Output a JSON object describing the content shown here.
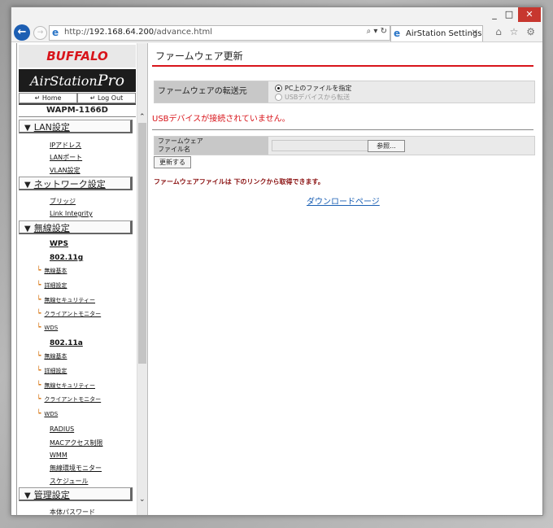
{
  "browser": {
    "window_controls": {
      "minimize": "_",
      "maximize": "□",
      "close": "✕"
    },
    "back_icon": "←",
    "forward_icon": "→",
    "url_prefix": "http://",
    "url_host": "192.168.64.200",
    "url_path": "/advance.html",
    "address_tools": "⌕ ▾ ↻",
    "tab_title": "AirStation Settings",
    "tab_close": "✕",
    "toolbar_icons": "⌂ ☆ ⚙"
  },
  "sidebar": {
    "brand": "BUFFALO",
    "product": "AirStation",
    "product_suffix": "Pro",
    "home": "Home",
    "logout": "Log Out",
    "model": "WAPM-1166D",
    "sections": [
      {
        "label": "LAN設定"
      },
      {
        "label": "ネットワーク設定"
      },
      {
        "label": "無線設定"
      },
      {
        "label": "管理設定"
      }
    ],
    "lan_links": [
      "IPアドレス",
      "LANポート",
      "VLAN設定"
    ],
    "network_links": [
      "ブリッジ",
      "Link Integrity"
    ],
    "wireless_top": "WPS",
    "band_g": "802.11g",
    "band_a": "802.11a",
    "sub_items": [
      "無線基本",
      "詳細設定",
      "無線セキュリティー",
      "クライアントモニター",
      "WDS"
    ],
    "wireless_links": [
      "RADIUS",
      "MACアクセス制限",
      "WMM",
      "無線環境モニター",
      "スケジュール"
    ],
    "admin_links": [
      "本体パスワード"
    ]
  },
  "main": {
    "title": "ファームウェア更新",
    "transfer_label": "ファームウェアの転送元",
    "option_pc": "PC上のファイルを指定",
    "option_usb": "USBデバイスから転送",
    "usb_message": "USBデバイスが接続されていません。",
    "file_label_line1": "ファームウェア",
    "file_label_line2": "ファイル名",
    "browse_button": "参照...",
    "update_button": "更新する",
    "firmware_note": "ファームウェアファイルは 下のリンクから取得できます。",
    "download_link": "ダウンロードページ"
  },
  "colors": {
    "accent_red": "#d8151b",
    "link_blue": "#1a5fb4",
    "ie_blue": "#1d5fb3"
  }
}
